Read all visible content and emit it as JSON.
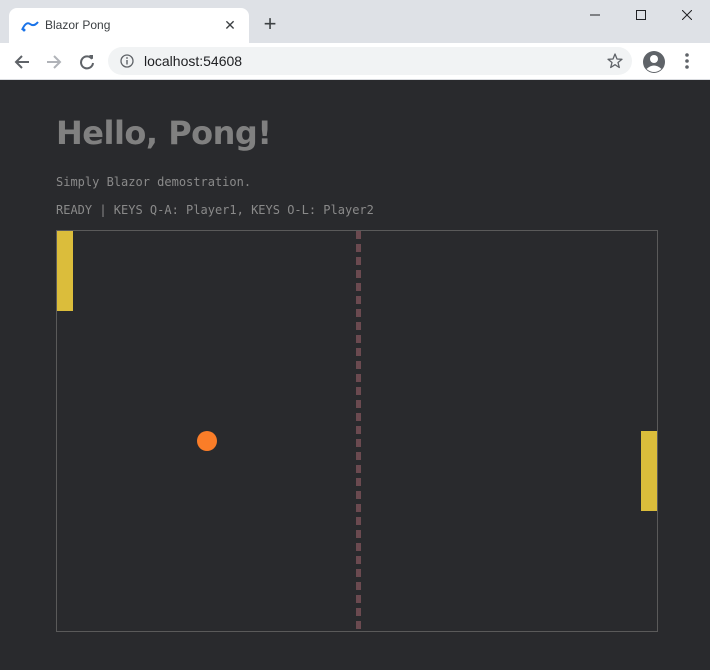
{
  "browser": {
    "tab": {
      "title": "Blazor Pong",
      "favicon": "blazor-icon"
    },
    "window_controls": {
      "minimize_icon": "minimize-icon",
      "maximize_icon": "maximize-icon",
      "close_icon": "close-icon"
    },
    "address_bar": {
      "url": "localhost:54608",
      "info_icon": "info-icon",
      "bookmark_icon": "star-icon"
    }
  },
  "page": {
    "title": "Hello, Pong!",
    "subtitle": "Simply Blazor demostration.",
    "status_line": "READY | KEYS Q-A: Player1, KEYS O-L: Player2"
  },
  "colors": {
    "background": "#292a2d",
    "paddle": "#dbbd3b",
    "ball": "#fa7d28",
    "net": "#6b4a50",
    "court_border": "#5a5a5a"
  }
}
